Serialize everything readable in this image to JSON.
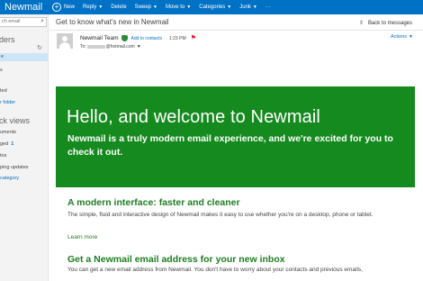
{
  "app": {
    "title": "Newmail"
  },
  "toolbar": {
    "items": [
      {
        "label": "New"
      },
      {
        "label": "Reply"
      },
      {
        "label": "Delete"
      },
      {
        "label": "Sweep"
      },
      {
        "label": "Move to"
      },
      {
        "label": "Categories"
      },
      {
        "label": "Junk"
      },
      {
        "label": "···"
      }
    ]
  },
  "sidebar": {
    "search_placeholder": "ch email",
    "folders_heading": "ders",
    "folder_items": [
      "e",
      "s",
      "ted",
      "r folder"
    ],
    "quick_views_heading": "ck views",
    "quick_items": [
      {
        "label": "uments",
        "count": ""
      },
      {
        "label": "ged",
        "count": "1"
      },
      {
        "label": "tos",
        "count": ""
      },
      {
        "label": "ping updates",
        "count": ""
      }
    ],
    "new_category": "category"
  },
  "message": {
    "subject": "Get to know what's new in Newmail",
    "back_label": "Back to messages",
    "sender": "Newmail Team",
    "add_contact": "Add to contacts",
    "time": "1:23 PM",
    "to_prefix": "To:",
    "to_domain": "@hotmail.com",
    "actions": "Actions"
  },
  "body": {
    "hero_title": "Hello, and welcome to Newmail",
    "hero_text": "Newmail is a truly modern email experience, and we're excited for you to check it out.",
    "section1_title": "A modern interface: faster and cleaner",
    "section1_text": "The simple, fluid and interactive design of Newmail makes it easy to use whether you're on a desktop, phone or tablet.",
    "learn_more": "Learn more",
    "section2_title": "Get a Newmail email address for your new inbox",
    "section2_text": "You can get a new email address from Newmail. You don't have to worry about your contacts and previous emails,"
  },
  "colors": {
    "accent": "#0072c6",
    "hero": "#158a1e",
    "section_title": "#1e7d22",
    "flag": "#e81123"
  },
  "icons": {
    "new": "plus-circle-icon",
    "search": "search-icon",
    "back": "back-arrow-icon",
    "flag": "flag-icon",
    "verified": "shield-icon"
  }
}
